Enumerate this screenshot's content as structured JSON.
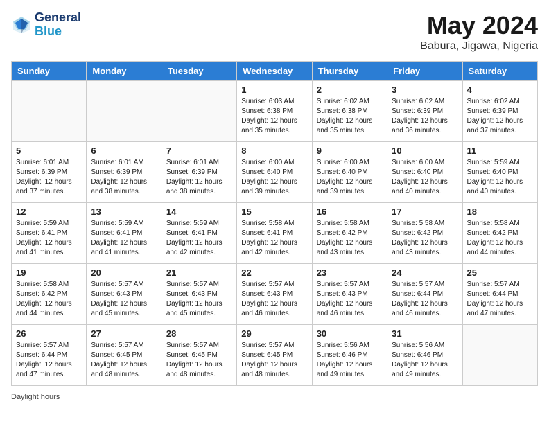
{
  "header": {
    "logo_line1": "General",
    "logo_line2": "Blue",
    "month": "May 2024",
    "location": "Babura, Jigawa, Nigeria"
  },
  "weekdays": [
    "Sunday",
    "Monday",
    "Tuesday",
    "Wednesday",
    "Thursday",
    "Friday",
    "Saturday"
  ],
  "weeks": [
    [
      {
        "day": "",
        "info": ""
      },
      {
        "day": "",
        "info": ""
      },
      {
        "day": "",
        "info": ""
      },
      {
        "day": "1",
        "info": "Sunrise: 6:03 AM\nSunset: 6:38 PM\nDaylight: 12 hours\nand 35 minutes."
      },
      {
        "day": "2",
        "info": "Sunrise: 6:02 AM\nSunset: 6:38 PM\nDaylight: 12 hours\nand 35 minutes."
      },
      {
        "day": "3",
        "info": "Sunrise: 6:02 AM\nSunset: 6:39 PM\nDaylight: 12 hours\nand 36 minutes."
      },
      {
        "day": "4",
        "info": "Sunrise: 6:02 AM\nSunset: 6:39 PM\nDaylight: 12 hours\nand 37 minutes."
      }
    ],
    [
      {
        "day": "5",
        "info": "Sunrise: 6:01 AM\nSunset: 6:39 PM\nDaylight: 12 hours\nand 37 minutes."
      },
      {
        "day": "6",
        "info": "Sunrise: 6:01 AM\nSunset: 6:39 PM\nDaylight: 12 hours\nand 38 minutes."
      },
      {
        "day": "7",
        "info": "Sunrise: 6:01 AM\nSunset: 6:39 PM\nDaylight: 12 hours\nand 38 minutes."
      },
      {
        "day": "8",
        "info": "Sunrise: 6:00 AM\nSunset: 6:40 PM\nDaylight: 12 hours\nand 39 minutes."
      },
      {
        "day": "9",
        "info": "Sunrise: 6:00 AM\nSunset: 6:40 PM\nDaylight: 12 hours\nand 39 minutes."
      },
      {
        "day": "10",
        "info": "Sunrise: 6:00 AM\nSunset: 6:40 PM\nDaylight: 12 hours\nand 40 minutes."
      },
      {
        "day": "11",
        "info": "Sunrise: 5:59 AM\nSunset: 6:40 PM\nDaylight: 12 hours\nand 40 minutes."
      }
    ],
    [
      {
        "day": "12",
        "info": "Sunrise: 5:59 AM\nSunset: 6:41 PM\nDaylight: 12 hours\nand 41 minutes."
      },
      {
        "day": "13",
        "info": "Sunrise: 5:59 AM\nSunset: 6:41 PM\nDaylight: 12 hours\nand 41 minutes."
      },
      {
        "day": "14",
        "info": "Sunrise: 5:59 AM\nSunset: 6:41 PM\nDaylight: 12 hours\nand 42 minutes."
      },
      {
        "day": "15",
        "info": "Sunrise: 5:58 AM\nSunset: 6:41 PM\nDaylight: 12 hours\nand 42 minutes."
      },
      {
        "day": "16",
        "info": "Sunrise: 5:58 AM\nSunset: 6:42 PM\nDaylight: 12 hours\nand 43 minutes."
      },
      {
        "day": "17",
        "info": "Sunrise: 5:58 AM\nSunset: 6:42 PM\nDaylight: 12 hours\nand 43 minutes."
      },
      {
        "day": "18",
        "info": "Sunrise: 5:58 AM\nSunset: 6:42 PM\nDaylight: 12 hours\nand 44 minutes."
      }
    ],
    [
      {
        "day": "19",
        "info": "Sunrise: 5:58 AM\nSunset: 6:42 PM\nDaylight: 12 hours\nand 44 minutes."
      },
      {
        "day": "20",
        "info": "Sunrise: 5:57 AM\nSunset: 6:43 PM\nDaylight: 12 hours\nand 45 minutes."
      },
      {
        "day": "21",
        "info": "Sunrise: 5:57 AM\nSunset: 6:43 PM\nDaylight: 12 hours\nand 45 minutes."
      },
      {
        "day": "22",
        "info": "Sunrise: 5:57 AM\nSunset: 6:43 PM\nDaylight: 12 hours\nand 46 minutes."
      },
      {
        "day": "23",
        "info": "Sunrise: 5:57 AM\nSunset: 6:43 PM\nDaylight: 12 hours\nand 46 minutes."
      },
      {
        "day": "24",
        "info": "Sunrise: 5:57 AM\nSunset: 6:44 PM\nDaylight: 12 hours\nand 46 minutes."
      },
      {
        "day": "25",
        "info": "Sunrise: 5:57 AM\nSunset: 6:44 PM\nDaylight: 12 hours\nand 47 minutes."
      }
    ],
    [
      {
        "day": "26",
        "info": "Sunrise: 5:57 AM\nSunset: 6:44 PM\nDaylight: 12 hours\nand 47 minutes."
      },
      {
        "day": "27",
        "info": "Sunrise: 5:57 AM\nSunset: 6:45 PM\nDaylight: 12 hours\nand 48 minutes."
      },
      {
        "day": "28",
        "info": "Sunrise: 5:57 AM\nSunset: 6:45 PM\nDaylight: 12 hours\nand 48 minutes."
      },
      {
        "day": "29",
        "info": "Sunrise: 5:57 AM\nSunset: 6:45 PM\nDaylight: 12 hours\nand 48 minutes."
      },
      {
        "day": "30",
        "info": "Sunrise: 5:56 AM\nSunset: 6:46 PM\nDaylight: 12 hours\nand 49 minutes."
      },
      {
        "day": "31",
        "info": "Sunrise: 5:56 AM\nSunset: 6:46 PM\nDaylight: 12 hours\nand 49 minutes."
      },
      {
        "day": "",
        "info": ""
      }
    ]
  ],
  "footer": {
    "daylight_label": "Daylight hours"
  }
}
